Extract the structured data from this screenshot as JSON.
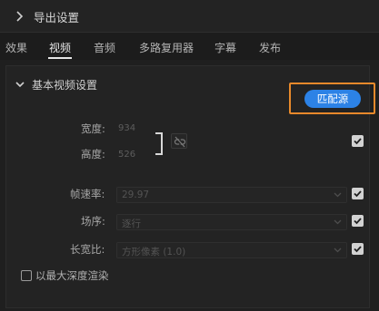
{
  "header": {
    "title": "导出设置",
    "icon": "chevron-right-icon"
  },
  "tabs": [
    {
      "label": "效果",
      "active": false
    },
    {
      "label": "视频",
      "active": true
    },
    {
      "label": "音频",
      "active": false
    },
    {
      "label": "多路复用器",
      "active": false
    },
    {
      "label": "字幕",
      "active": false
    },
    {
      "label": "发布",
      "active": false
    }
  ],
  "section": {
    "title": "基本视频设置",
    "match_source_label": "匹配源",
    "width_label": "宽度:",
    "width_value": "934",
    "height_label": "高度:",
    "height_value": "526",
    "frame_rate_label": "帧速率:",
    "frame_rate_value": "29.97",
    "field_order_label": "场序:",
    "field_order_value": "逐行",
    "aspect_label": "长宽比:",
    "aspect_value": "方形像素 (1.0)",
    "max_depth_label": "以最大深度渲染"
  },
  "checkboxes": {
    "size_checked": true,
    "frame_rate_checked": true,
    "field_order_checked": true,
    "aspect_checked": true,
    "max_depth_checked": false
  },
  "colors": {
    "accent": "#2c82e6",
    "highlight": "#e8892b",
    "background": "#1f1f1f"
  }
}
